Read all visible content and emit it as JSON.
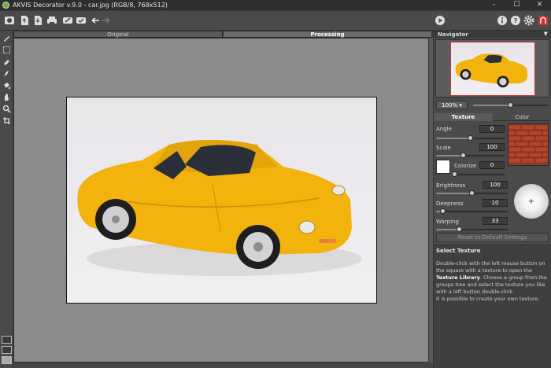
{
  "window": {
    "title": "AKVIS Decorator v.9.0 - car.jpg (RGB/8, 768x512)",
    "minimize": "–",
    "maximize": "☐",
    "close": "✕"
  },
  "toolbar": {
    "icons": [
      "home-icon",
      "open-icon",
      "save-icon",
      "print-icon",
      "batch-icon",
      "run-icon",
      "undo-icon",
      "redo-icon",
      "play-icon",
      "info-icon",
      "help-icon",
      "settings-icon",
      "akvis-icon"
    ]
  },
  "tools": [
    "brush-icon",
    "selection-icon",
    "eraser-icon",
    "smudge-icon",
    "bucket-icon",
    "hand-icon",
    "zoom-icon",
    "crop-icon"
  ],
  "tabs": {
    "original": "Original",
    "processing": "Processing"
  },
  "navigator": {
    "title": "Navigator",
    "zoom": "100%",
    "zoom_slider": 0.5
  },
  "settings": {
    "tab_texture": "Texture",
    "tab_color": "Color",
    "angle_label": "Angle",
    "angle_value": "0",
    "angle_slider": 0.5,
    "scale_label": "Scale",
    "scale_value": "100",
    "scale_slider": 0.4,
    "colorize_label": "Colorize",
    "colorize_value": "0",
    "colorize_slider": 0.02,
    "brightness_label": "Brightness",
    "brightness_value": "100",
    "brightness_slider": 0.5,
    "deepness_label": "Deepness",
    "deepness_value": "10",
    "deepness_slider": 0.1,
    "warping_label": "Warping",
    "warping_value": "33",
    "warping_slider": 0.33,
    "reset_label": "Reset to Default Settings"
  },
  "help": {
    "title": "Select Texture",
    "line1": "Double-click with the left mouse button on the square with a texture to open the ",
    "bold1": "Texture Library",
    "line2": ". Choose a group from the groups tree and select the texture you like with a left button double-click.",
    "line3": "It is possible to create your own texture."
  },
  "colors": {
    "car": "#f1b30c",
    "brick": "#b5442e",
    "accent": "#c33"
  }
}
